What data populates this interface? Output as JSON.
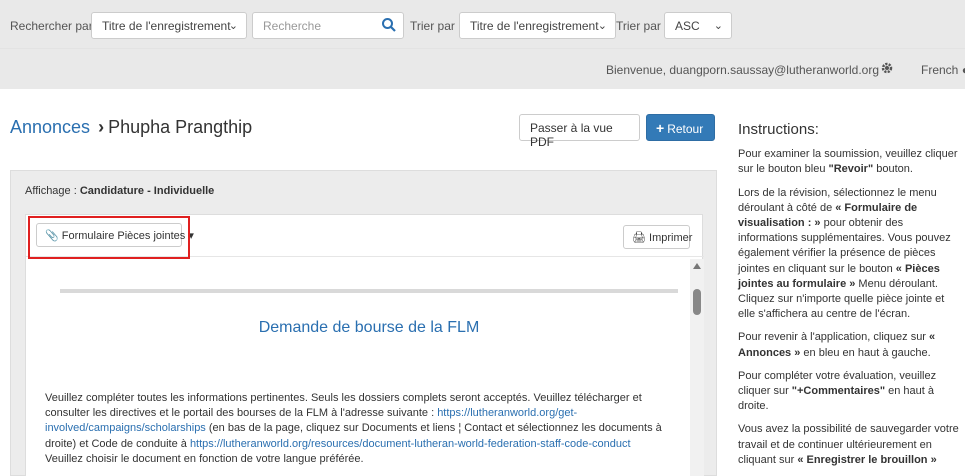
{
  "search_bar": {
    "search_by_label": "Rechercher par",
    "search_by_value": "Titre de l'enregistrement",
    "search_placeholder": "Recherche",
    "sort_by_label": "Trier par",
    "sort_by_value": "Titre de l'enregistrement",
    "order_label": "Trier par",
    "order_value": "ASC"
  },
  "user_bar": {
    "welcome": "Bienvenue, duangporn.saussay@lutheranworld.org",
    "language": "French"
  },
  "breadcrumb": {
    "parent": "Annonces",
    "current": "Phupha Prangthip"
  },
  "actions": {
    "pdf_view": "Passer à la vue PDF",
    "back": "Retour"
  },
  "display": {
    "label": "Affichage :",
    "value": "Candidature - Individuelle"
  },
  "card": {
    "attachments_button": "Formulaire Pièces jointes",
    "print_button": "Imprimer"
  },
  "document": {
    "title": "Demande de bourse de la FLM",
    "p1_a": "Veuillez compléter toutes les informations pertinentes. Seuls les dossiers complets seront acceptés. Veuillez télécharger et consulter les directives et le portail des bourses de la FLM à l'adresse suivante : ",
    "link1": "https://lutheranworld.org/get-involved/campaigns/scholarships",
    "p1_b": " (en bas de la page, cliquez sur Documents et liens ¦ Contact et sélectionnez les documents à droite) et Code de conduite à ",
    "link2": "https://lutheranworld.org/resources/document-lutheran-world-federation-staff-code-conduct",
    "p2": "Veuillez choisir le document en fonction de votre langue préférée."
  },
  "instructions": {
    "title": "Instructions:",
    "p1_a": "Pour examiner la soumission, veuillez cliquer sur le bouton bleu ",
    "p1_b": "\"Revoir\"",
    "p1_c": " bouton.",
    "p2_a": "Lors de la révision, sélectionnez le menu déroulant à côté de ",
    "p2_b": "« Formulaire de visualisation : »",
    "p2_c": " pour obtenir des informations supplémentaires. Vous pouvez également vérifier la présence de pièces jointes en cliquant sur le bouton ",
    "p2_d": "« Pièces jointes au formulaire »",
    "p2_e": " Menu déroulant. Cliquez sur n'importe quelle pièce jointe et elle s'affichera au centre de l'écran.",
    "p3_a": "Pour revenir à l'application, cliquez sur ",
    "p3_b": "« Annonces »",
    "p3_c": " en bleu en haut à gauche.",
    "p4_a": "Pour compléter votre évaluation, veuillez cliquer sur ",
    "p4_b": "\"+Commentaires\"",
    "p4_c": " en haut à droite.",
    "p5_a": "Vous avez la possibilité de sauvegarder votre travail et de continuer ultérieurement en cliquant sur ",
    "p5_b": "« Enregistrer le brouillon »"
  },
  "colors": {
    "link_blue": "#2a6fb0",
    "primary_button": "#337ab7",
    "highlight_red": "#e02020"
  },
  "icons": [
    "search-icon",
    "chevron-down-icon",
    "gear-icon",
    "globe-icon",
    "plus-icon",
    "paperclip-icon",
    "printer-icon",
    "caret-down-icon"
  ]
}
